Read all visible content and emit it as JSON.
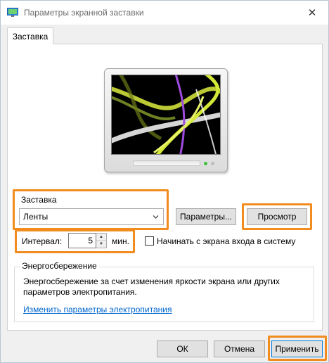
{
  "window": {
    "title": "Параметры экранной заставки",
    "close_glyph": "✕"
  },
  "tabs": [
    {
      "label": "Заставка",
      "selected": true
    }
  ],
  "screensaver": {
    "group_label": "Заставка",
    "selected": "Ленты",
    "settings_button": "Параметры...",
    "preview_button": "Просмотр",
    "interval_label": "Интервал:",
    "interval_value": "5",
    "interval_unit": "мин.",
    "logon_checkbox_label": "Начинать с экрана входа в систему",
    "logon_checked": false
  },
  "power": {
    "group_label": "Энергосбережение",
    "description_line1": "Энергосбережение за счет изменения яркости экрана или других",
    "description_line2": "параметров электропитания.",
    "link": "Изменить параметры электропитания"
  },
  "footer": {
    "ok": "ОК",
    "cancel": "Отмена",
    "apply": "Применить"
  },
  "colors": {
    "highlight": "#f28c1e",
    "accent": "#0078d7",
    "link": "#0066cc"
  },
  "icons": {
    "app": "display-settings-icon",
    "close": "close-icon",
    "dropdown": "chevron-down-icon",
    "spin_up": "spin-up-arrow-icon",
    "spin_down": "spin-down-arrow-icon"
  }
}
